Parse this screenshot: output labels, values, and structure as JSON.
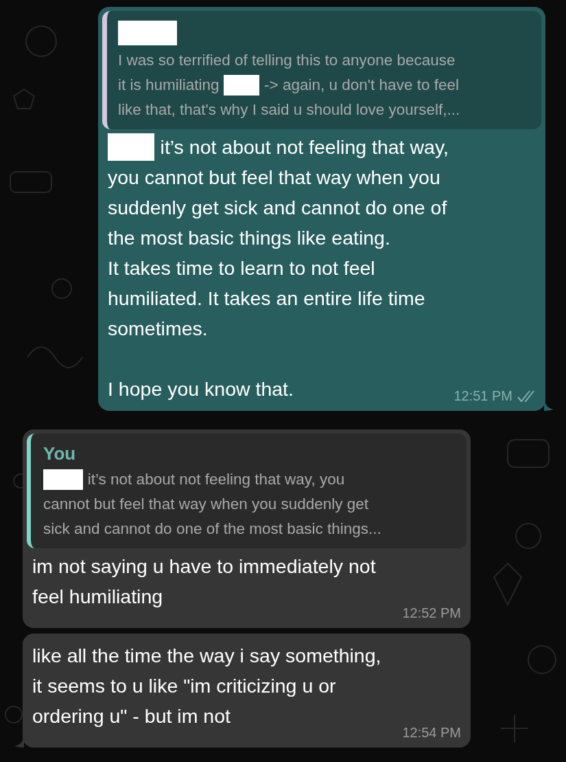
{
  "messages": [
    {
      "kind": "outgoing",
      "tail": true,
      "quote": {
        "author": [
          {
            "kind": "redaction"
          }
        ],
        "lines": [
          [
            {
              "kind": "text",
              "text": "I was so terrified of telling this to anyone because"
            }
          ],
          [
            {
              "kind": "text",
              "text": "it is humiliating"
            },
            {
              "kind": "redaction"
            },
            {
              "kind": "text",
              "text": "-> again, u don't have to feel"
            }
          ],
          [
            {
              "kind": "text",
              "text": "like that, that's why I said u should love yourself,..."
            }
          ]
        ]
      },
      "body": [
        {
          "lines": [
            [
              {
                "kind": "redaction"
              },
              {
                "kind": "text",
                "text": "it’s not about not feeling that way,"
              }
            ],
            [
              {
                "kind": "text",
                "text": "you cannot but feel that way when you"
              }
            ],
            [
              {
                "kind": "text",
                "text": "suddenly get sick and cannot do one of"
              }
            ],
            [
              {
                "kind": "text",
                "text": "the most basic things like eating."
              }
            ],
            [
              {
                "kind": "text",
                "text": "It takes time to learn to not feel"
              }
            ],
            [
              {
                "kind": "text",
                "text": "humiliated. It takes an entire life time"
              }
            ],
            [
              {
                "kind": "text",
                "text": "sometimes."
              }
            ]
          ]
        },
        {
          "lines": [
            [
              {
                "kind": "text",
                "text": "I hope you know that."
              }
            ]
          ]
        }
      ],
      "time": "12:51 PM",
      "read": true
    },
    {
      "kind": "incoming",
      "tail": false,
      "quote": {
        "author": [
          {
            "kind": "text",
            "text": "You"
          }
        ],
        "lines": [
          [
            {
              "kind": "redaction"
            },
            {
              "kind": "text",
              "text": "it’s not about not feeling that way, you"
            }
          ],
          [
            {
              "kind": "text",
              "text": "cannot but feel that way when you suddenly get"
            }
          ],
          [
            {
              "kind": "text",
              "text": "sick and cannot do one of the most basic things..."
            }
          ]
        ]
      },
      "body": [
        {
          "lines": [
            [
              {
                "kind": "text",
                "text": "im not saying u have to immediately not"
              }
            ],
            [
              {
                "kind": "text",
                "text": "feel humiliating"
              }
            ]
          ]
        }
      ],
      "time": "12:52 PM"
    },
    {
      "kind": "incoming",
      "tail": true,
      "body": [
        {
          "lines": [
            [
              {
                "kind": "text",
                "text": "like all the time the way i say something,"
              }
            ],
            [
              {
                "kind": "text",
                "text": "it seems to u like \"im criticizing u or"
              }
            ],
            [
              {
                "kind": "text",
                "text": "ordering u\" - but im not"
              }
            ]
          ]
        }
      ],
      "time": "12:54 PM"
    }
  ]
}
